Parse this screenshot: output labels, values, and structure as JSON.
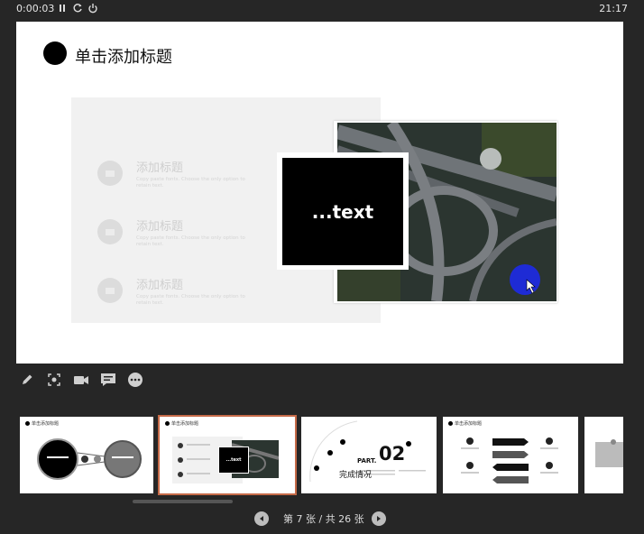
{
  "top_bar": {
    "timer": "0:00:03",
    "clock": "21:17"
  },
  "slide": {
    "title": "单击添加标题",
    "box_text": "...text",
    "rows": [
      {
        "title": "添加标题",
        "text": "Copy paste fonts. Choose the only option to retain text."
      },
      {
        "title": "添加标题",
        "text": "Copy paste fonts. Choose the only option to retain text."
      },
      {
        "title": "添加标题",
        "text": "Copy paste fonts. Choose the only option to retain text."
      }
    ]
  },
  "thumbnails": [
    {
      "title": "单击添加标题"
    },
    {
      "title": "单击添加标题",
      "box_text": "...text"
    },
    {
      "part": "PART.",
      "number": "02",
      "subtitle": "完成情况"
    },
    {
      "title": "单击添加标题"
    }
  ],
  "pager": {
    "text": "第 7 张 / 共 26 张"
  },
  "colors": {
    "background": "#262626",
    "selected_border": "#c56a48",
    "pointer_highlight": "#1d2ae8"
  }
}
